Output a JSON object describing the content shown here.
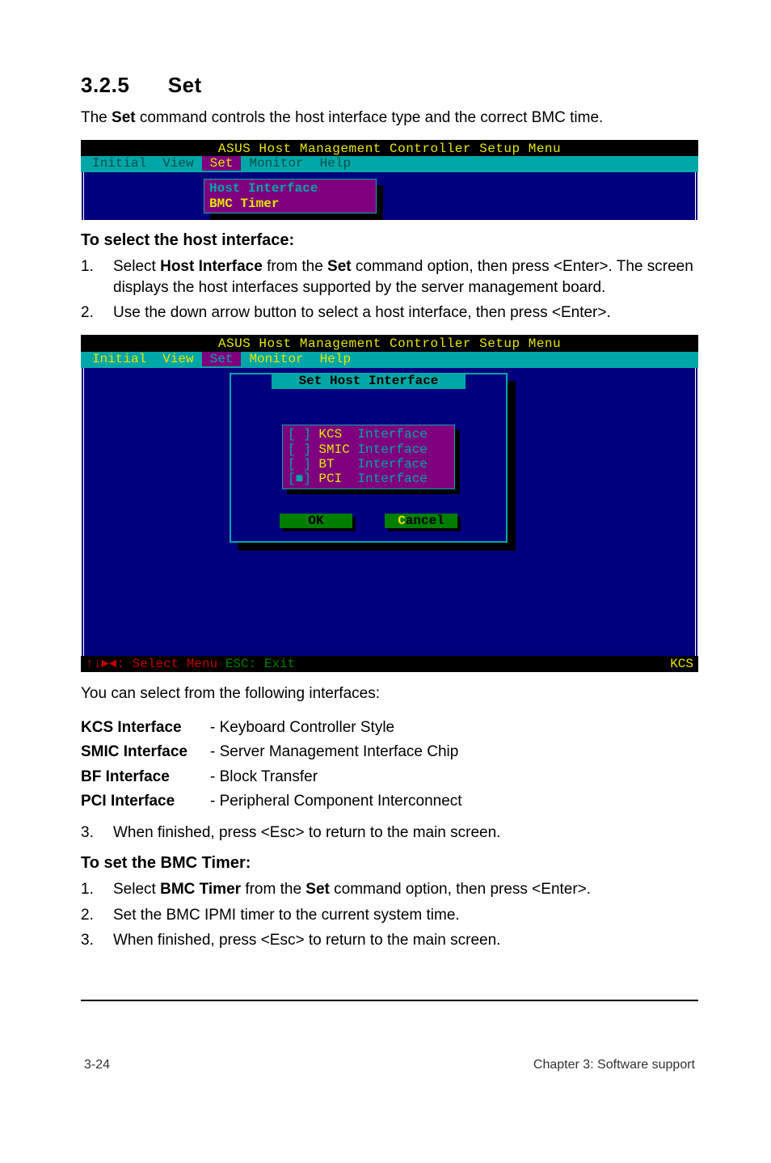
{
  "heading_num": "3.2.5",
  "heading_title": "Set",
  "intro_pre": "The ",
  "intro_bold": "Set",
  "intro_post": " command controls the host interface type and the correct BMC time.",
  "term1": {
    "title": "ASUS Host Management Controller Setup Menu",
    "menu": {
      "initial": "Initial",
      "view": "View",
      "set": "Set",
      "monitor": "Monitor",
      "help": "Help"
    },
    "popup": {
      "line1": "Host Interface",
      "line2": "BMC Timer"
    }
  },
  "subheading1": "To select the host interface:",
  "step1_num": "1.",
  "step1_pre": "Select ",
  "step1_b1": "Host Interface",
  "step1_mid": " from the ",
  "step1_b2": "Set",
  "step1_post": " command option, then press <Enter>. The screen displays the host interfaces supported by the server management board.",
  "step2_num": "2.",
  "step2_txt": "Use the down arrow button to select a host interface, then press <Enter>.",
  "term2": {
    "title": "ASUS Host Management Controller Setup Menu",
    "menu": {
      "initial": "Initial",
      "view": "View",
      "set": "Set",
      "monitor": "Monitor",
      "help": "Help"
    },
    "dialog_title": "Set Host Interface",
    "opt1_prefix": "[ ] ",
    "opt1_name": "KCS",
    "opt1_tail": "  Interface",
    "opt2_prefix": "[ ] ",
    "opt2_name": "SMIC",
    "opt2_tail": " Interface",
    "opt3_prefix": "[ ] ",
    "opt3_name": "BT",
    "opt3_tail": "   Interface",
    "opt4_prefix": "[■] ",
    "opt4_name": "PCI",
    "opt4_tail": "  Interface",
    "ok": "OK",
    "cancel": "Cancel",
    "cancel_hot": "C",
    "status_left_a": "↑↓►◄: Select Menu  ",
    "status_left_b": "ESC: Exit",
    "status_right": "KCS"
  },
  "after_term2": "You can select from the following interfaces:",
  "iface1_lab": "KCS Interface",
  "iface1_val": "-   Keyboard Controller Style",
  "iface2_lab": "SMIC Interface",
  "iface2_val": "-   Server Management Interface Chip",
  "iface3_lab": "BF Interface",
  "iface3_val": "-   Block Transfer",
  "iface4_lab": "PCI Interface",
  "iface4_val": "-   Peripheral Component Interconnect",
  "step3_num": "3.",
  "step3_txt": "When finished, press <Esc> to return to the main screen.",
  "subheading2": "To set the BMC Timer:",
  "bmcs1_num": "1.",
  "bmcs1_pre": "Select ",
  "bmcs1_b": "BMC Timer",
  "bmcs1_mid": " from the ",
  "bmcs1_b2": "Set",
  "bmcs1_post": " command option, then press <Enter>.",
  "bmcs2_num": "2.",
  "bmcs2_txt": "Set the BMC IPMI timer to the current system time.",
  "bmcs3_num": "3.",
  "bmcs3_txt": "When finished, press <Esc> to return to the main screen.",
  "footer_left": "3-24",
  "footer_right": "Chapter 3: Software support"
}
